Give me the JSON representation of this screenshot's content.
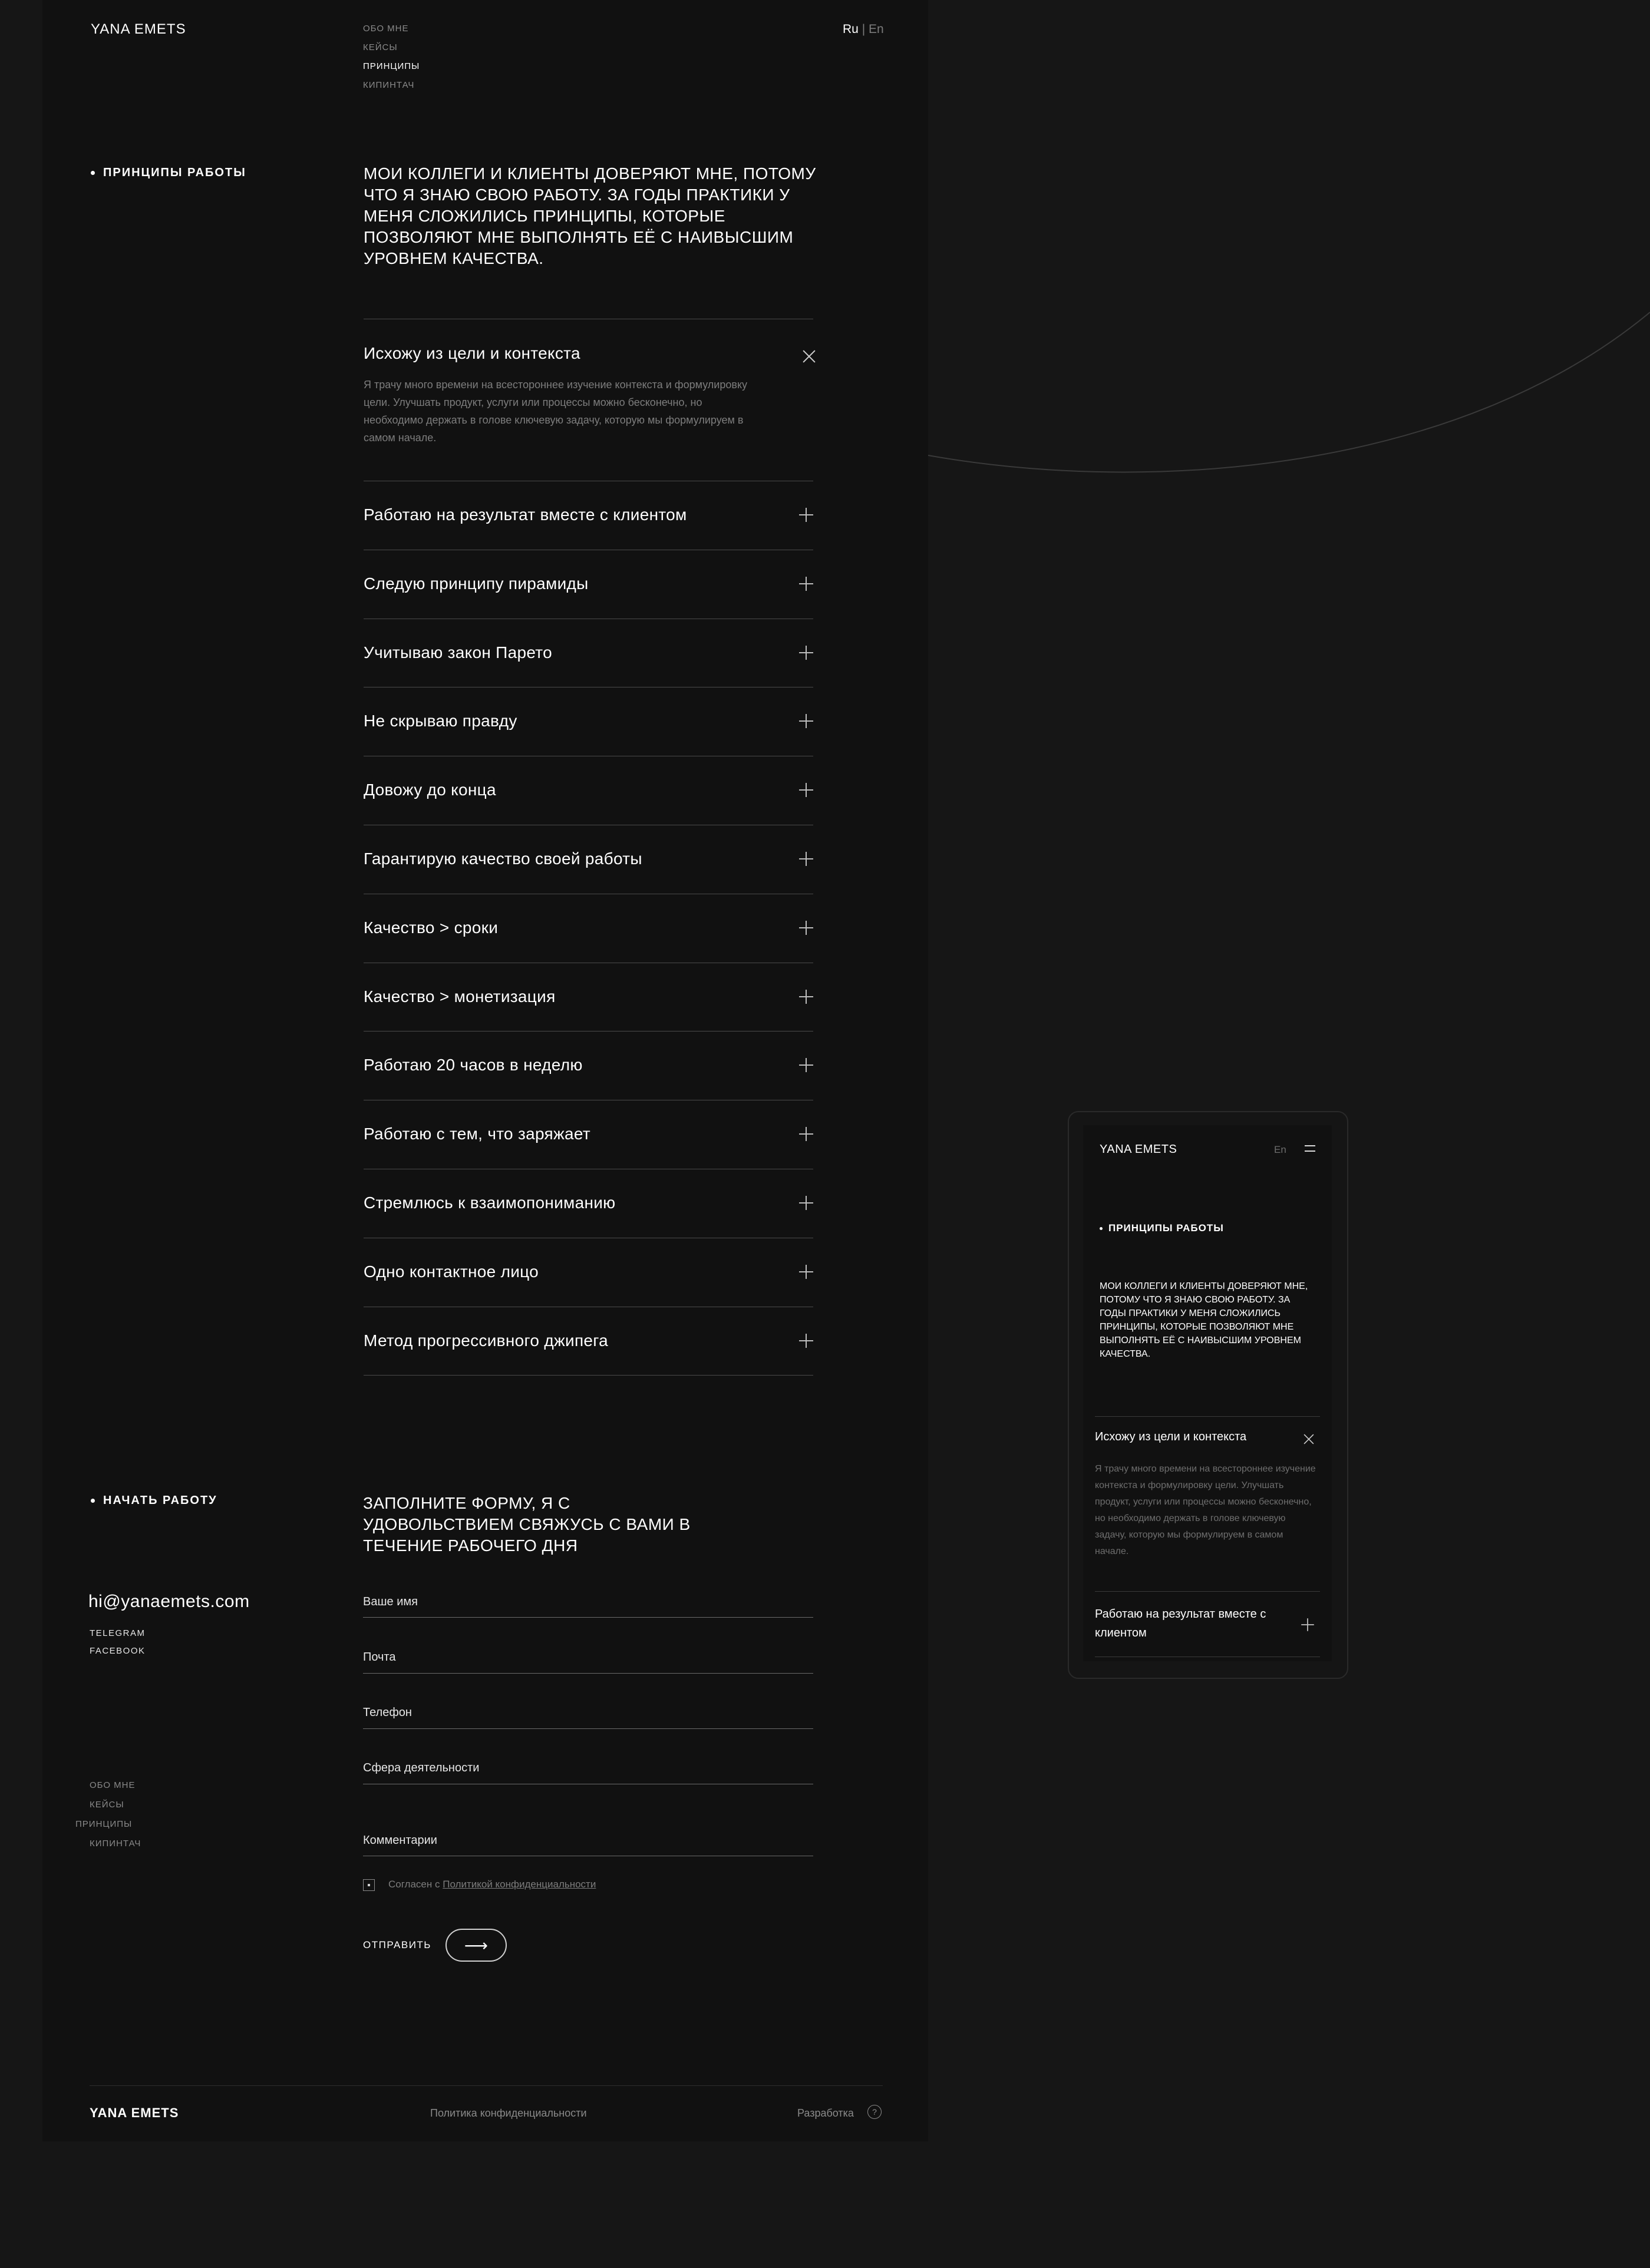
{
  "header": {
    "logo": "YANA EMETS",
    "nav": [
      "ОБО МНЕ",
      "КЕЙСЫ",
      "ПРИНЦИПЫ",
      "КИПИНТАЧ"
    ],
    "lang_current": "Ru",
    "lang_separator": "|",
    "lang_alt": "En"
  },
  "principles": {
    "label": "ПРИНЦИПЫ РАБОТЫ",
    "lead": "МОИ КОЛЛЕГИ И КЛИЕНТЫ ДОВЕРЯЮТ МНЕ, ПОТОМУ ЧТО Я ЗНАЮ СВОЮ РАБОТУ. ЗА ГОДЫ ПРАКТИКИ У МЕНЯ СЛОЖИЛИСЬ ПРИНЦИПЫ, КОТОРЫЕ ПОЗВОЛЯЮТ МНЕ ВЫПОЛНЯТЬ ЕЁ С НАИВЫСШИМ УРОВНЕМ КАЧЕСТВА.",
    "open_item": {
      "title": "Исхожу из цели и контекста",
      "body": "Я трачу много времени на всестороннее изучение контекста и формулировку цели. Улучшать продукт, услуги или процессы можно бесконечно, но необходимо держать в голове ключевую задачу, которую мы формулируем в самом начале."
    },
    "items": [
      "Работаю на результат вместе с клиентом",
      "Следую принципу пирамиды",
      "Учитываю закон Парето",
      "Не скрываю правду",
      "Довожу до конца",
      "Гарантирую качество своей работы",
      "Качество > сроки",
      "Качество > монетизация",
      "Работаю 20 часов в неделю",
      "Работаю с тем, что заряжает",
      "Стремлюсь к взаимопониманию",
      "Одно контактное лицо",
      "Метод прогрессивного джипега"
    ]
  },
  "contact": {
    "label": "НАЧАТЬ РАБОТУ",
    "lead": "ЗАПОЛНИТЕ ФОРМУ, Я С УДОВОЛЬСТВИЕМ СВЯЖУСЬ С ВАМИ В ТЕЧЕНИЕ РАБОЧЕГО ДНЯ",
    "email": "hi@yanaemets.com",
    "socials": [
      "TELEGRAM",
      "FACEBOOK"
    ],
    "nav": [
      "ОБО МНЕ",
      "КЕЙСЫ",
      "ПРИНЦИПЫ",
      "КИПИНТАЧ"
    ],
    "fields": [
      "Ваше имя",
      "Почта",
      "Телефон",
      "Сфера деятельности",
      "Комментарии"
    ],
    "consent_prefix": "Согласен с",
    "consent_link": "Политикой конфиденциальности",
    "submit": "ОТПРАВИТЬ",
    "submit_arrow": "⟶"
  },
  "footer": {
    "logo": "YANA EMETS",
    "privacy": "Политика конфиденциальности",
    "dev": "Разработка",
    "dev_icon": "?"
  },
  "mobile": {
    "logo": "YANA EMETS",
    "lang": "En",
    "label": "ПРИНЦИПЫ РАБОТЫ",
    "lead": "МОИ КОЛЛЕГИ И КЛИЕНТЫ ДОВЕРЯЮТ МНЕ, ПОТОМУ ЧТО Я ЗНАЮ СВОЮ РАБОТУ. ЗА ГОДЫ ПРАКТИКИ У МЕНЯ СЛОЖИЛИСЬ ПРИНЦИПЫ, КОТОРЫЕ ПОЗВОЛЯЮТ МНЕ ВЫПОЛНЯТЬ ЕЁ С НАИВЫСШИМ УРОВНЕМ КАЧЕСТВА.",
    "open_title": "Исхожу из цели и контекста",
    "open_body": "Я трачу много времени на всестороннее изучение контекста и формулировку цели. Улучшать продукт, услуги или процессы можно бесконечно, но необходимо держать в голове ключевую задачу, которую мы формулируем в самом начале.",
    "next_item": "Работаю на результат вместе с клиентом"
  }
}
